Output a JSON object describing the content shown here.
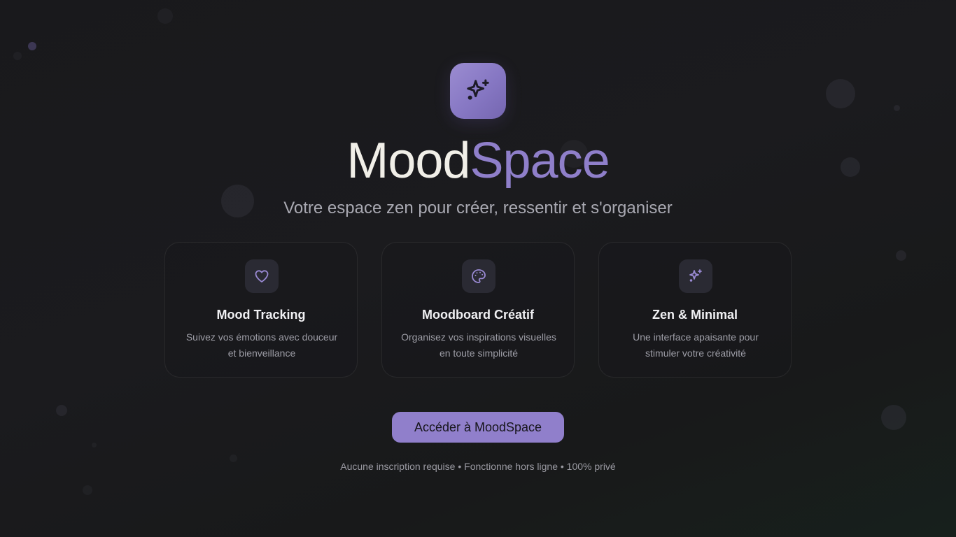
{
  "app": {
    "title_part_a": "Mood",
    "title_part_b": "Space",
    "subtitle": "Votre espace zen pour créer, ressentir et s'organiser",
    "logo_icon": "sparkles-icon"
  },
  "features": [
    {
      "icon": "heart-icon",
      "title": "Mood Tracking",
      "description": "Suivez vos émotions avec douceur et bienveillance"
    },
    {
      "icon": "palette-icon",
      "title": "Moodboard Créatif",
      "description": "Organisez vos inspirations visuelles en toute simplicité"
    },
    {
      "icon": "sparkles-icon",
      "title": "Zen & Minimal",
      "description": "Une interface apaisante pour stimuler votre créativité"
    }
  ],
  "cta": {
    "label": "Accéder à MoodSpace"
  },
  "footnote": "Aucune inscription requise • Fonctionne hors ligne • 100% privé",
  "colors": {
    "accent": "#907fcb",
    "title_light": "#f1efe8",
    "background": "#1a1a1d"
  }
}
